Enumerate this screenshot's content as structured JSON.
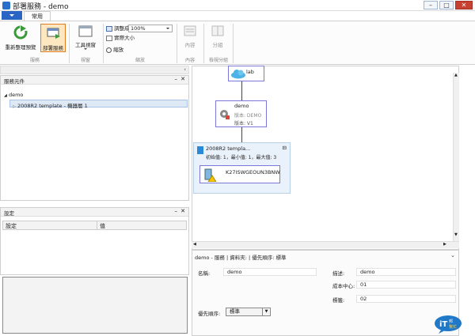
{
  "window": {
    "title": "部署服務 - demo",
    "min": "–",
    "max": "□",
    "close": "✕"
  },
  "ribbon": {
    "home_tab": "常用",
    "refresh_label": "重新整理預覽",
    "deploy_label": "部署服務",
    "group_service": "服務",
    "toolbox_label": "工具視窗",
    "group_view": "視窗",
    "fit_window": "調整成視窗大小",
    "actual_size": "實際大小",
    "zoom_label": "縮放",
    "zoom_value": "100%",
    "group_zoom": "縮放",
    "content_label": "內容",
    "group_content": "內容",
    "split_label": "分組",
    "group_split": "檢視分組"
  },
  "left_top": {
    "header": "服務元件",
    "tree_root": "demo",
    "tree_child": "2008R2 template - 機器層 1"
  },
  "left_mid": {
    "header": "設定",
    "col1": "設定",
    "col2": "值"
  },
  "diagram": {
    "cloud_label": "lab",
    "service_name": "demo",
    "service_release": "版本: DEMO",
    "service_version": "版本: V1",
    "tier_name": "2008R2 templa...",
    "tier_counts": "初始值: 1，最小值: 1，最大值: 3",
    "vm_name": "K27ISWGEOUN3BNW"
  },
  "properties": {
    "header": "demo - 服務 | 資料夾: | 優先順序: 標準",
    "name_label": "名稱:",
    "name_value": "demo",
    "desc_label": "描述:",
    "desc_value": "demo",
    "cost_label": "成本中心:",
    "cost_value": "01",
    "tag_label": "標籤:",
    "tag_value": "02",
    "prio_label": "優先順序:",
    "prio_value": "標準"
  },
  "logo": {
    "text": "iT邦",
    "subtext": "幫忙"
  }
}
